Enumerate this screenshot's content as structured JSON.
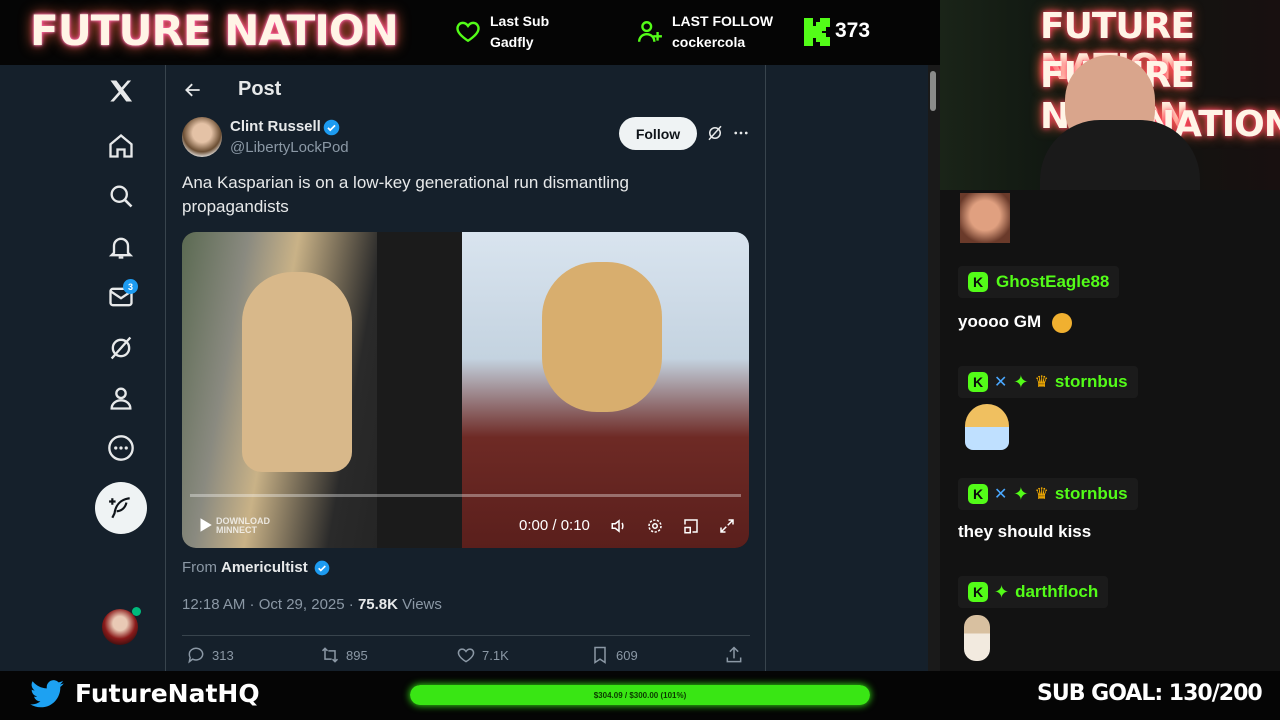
{
  "overlay": {
    "brand": "FUTURE NATION",
    "last_sub_label": "Last Sub",
    "last_sub_value": "Gadfly",
    "last_follow_label": "LAST FOLLOW",
    "last_follow_value": "cockercola",
    "viewer_count": "373",
    "twitter_handle": "FutureNatHQ",
    "progress_text": "$304.09 / $300.00 (101%)",
    "progress_fraction": 1.0,
    "sub_goal": "SUB GOAL: 130/200",
    "accent_green": "#53fc18"
  },
  "nav": {
    "items": [
      "x-logo-icon",
      "home-icon",
      "search-icon",
      "bell-icon",
      "mail-icon",
      "grok-icon",
      "profile-icon",
      "more-icon"
    ],
    "mail_badge": "3"
  },
  "post": {
    "header_title": "Post",
    "author_name": "Clint Russell",
    "author_handle": "@LibertyLockPod",
    "follow_label": "Follow",
    "text": "Ana Kasparian is on a low-key generational run dismantling propagandists",
    "video_time": "0:00 / 0:10",
    "watermark": "DOWNLOAD MINNECT",
    "from_label": "From",
    "from_account": "Americultist",
    "timestamp": "12:18 AM · Oct 29, 2025 ·",
    "views_count": "75.8K",
    "views_label": "Views",
    "replies": "313",
    "reposts": "895",
    "likes": "7.1K",
    "bookmarks": "609"
  },
  "cam": {
    "neon_lines": [
      "FUTURE NATION",
      "FUTURE NATION",
      "NATION"
    ]
  },
  "chat": {
    "messages": [
      {
        "name": "GhostEagle88",
        "text": "yoooo GM"
      },
      {
        "name": "stornbus",
        "text": ""
      },
      {
        "name": "stornbus",
        "text": "they should kiss"
      },
      {
        "name": "darthfloch",
        "text": ""
      }
    ]
  }
}
